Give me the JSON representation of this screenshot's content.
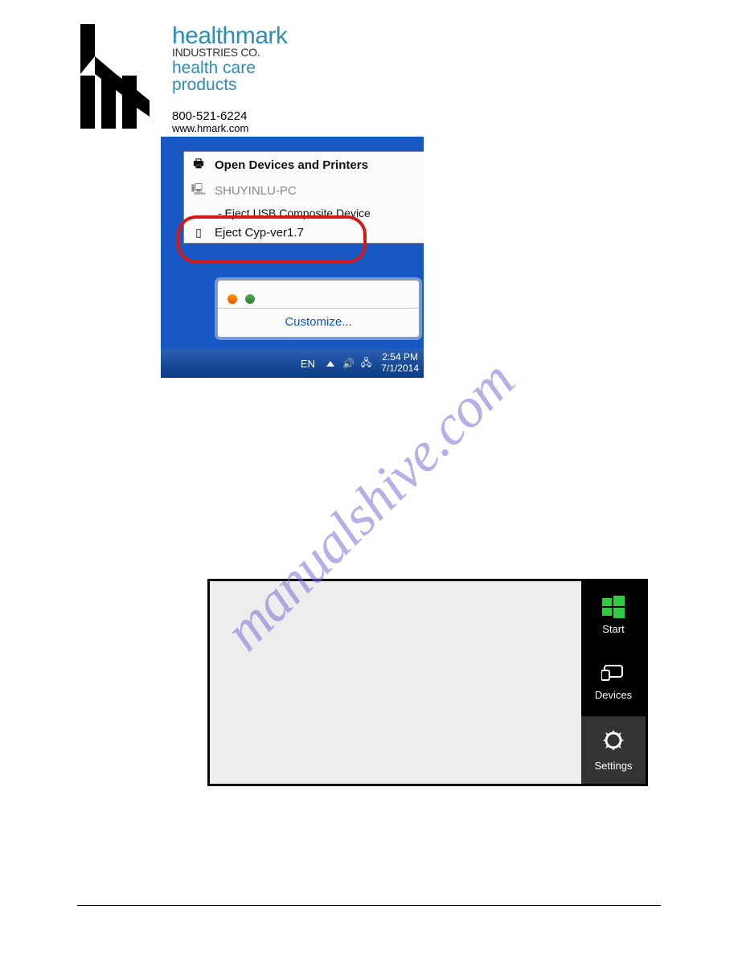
{
  "header": {
    "brand_title": "healthmark",
    "brand_subtitle": "INDUSTRIES CO.",
    "brand_tagline": "health care products",
    "phone": "800-521-6224",
    "website": "www.hmark.com"
  },
  "win7": {
    "menu_title": "Open Devices and Printers",
    "computer_name": "SHUYINLU-PC",
    "sub_item": "-  Eject USB Composite Device",
    "highlighted_item": "Eject Cyp-ver1.7",
    "customize_link": "Customize...",
    "language_indicator": "EN",
    "clock_time": "2:54 PM",
    "clock_date": "7/1/2014"
  },
  "win8": {
    "charms": {
      "start_label": "Start",
      "devices_label": "Devices",
      "settings_label": "Settings"
    }
  },
  "watermark_text": "manualshive.com"
}
